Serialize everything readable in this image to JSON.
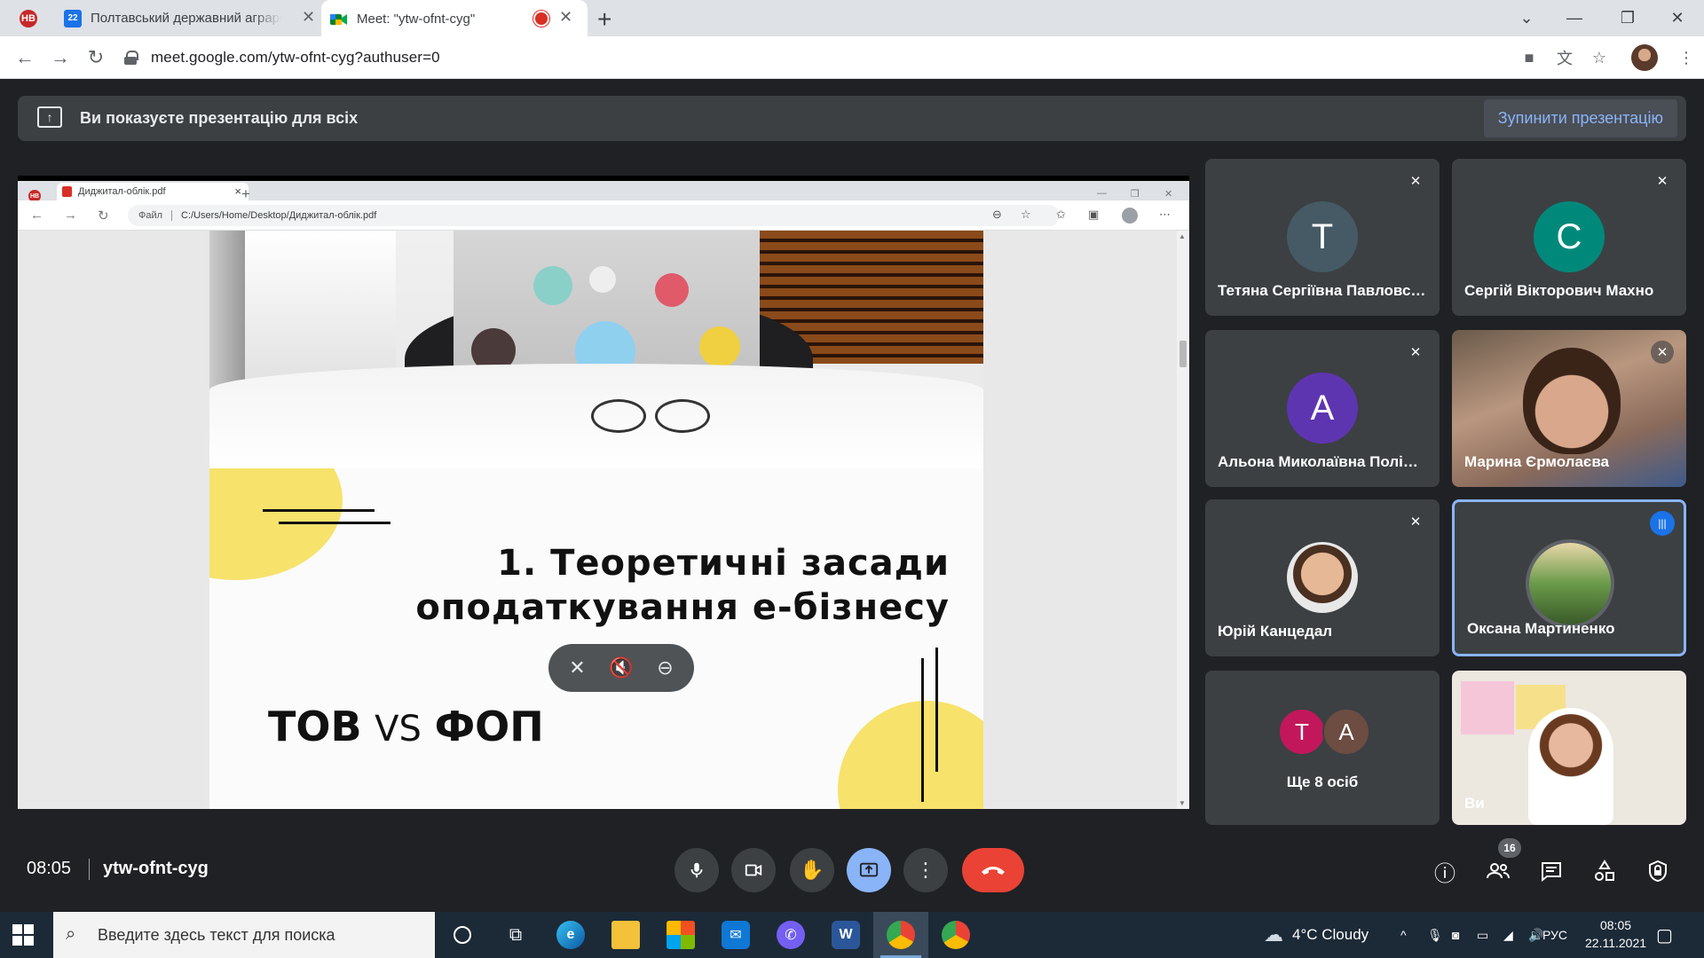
{
  "browser": {
    "tab_badge": "НВ",
    "tab1_title": "Полтавський державний аграрний",
    "tab1_favicon": "22",
    "tab2_title": "Meet: \"ytw-ofnt-cyg\"",
    "close_glyph": "✕",
    "new_tab_glyph": "+",
    "url": "meet.google.com/ytw-ofnt-cyg?authuser=0"
  },
  "banner": {
    "text": "Ви показуєте презентацію для всіх",
    "stop_label": "Зупинити презентацію"
  },
  "shared_screen": {
    "tab_title": "Диджитал-облік.pdf",
    "badge": "НВ",
    "file_label": "Файл",
    "path": "C:/Users/Home/Desktop/Диджитал-облік.pdf",
    "slide_title_line1": "1. Теоретичні засади",
    "slide_title_line2": "оподаткування е-бізнесу",
    "slide_sub_left": "ТОВ",
    "slide_sub_vs": "VS",
    "slide_sub_right": "ФОП"
  },
  "participants": [
    {
      "name": "Тетяна Сергіївна Павловська",
      "initial": "T",
      "color": "#455a64"
    },
    {
      "name": "Сергій Вікторович Махно",
      "initial": "C",
      "color": "#00897b"
    },
    {
      "name": "Альона Миколаївна Поліщук",
      "initial": "A",
      "color": "#5e35b1"
    },
    {
      "name": "Марина Єрмолаєва"
    },
    {
      "name": "Юрій Канцедал"
    },
    {
      "name": "Оксана Мартиненко"
    },
    {
      "more_label": "Ще 8 осіб",
      "initial_1": "T",
      "initial_2": "A"
    },
    {
      "name": "Ви"
    }
  ],
  "meeting": {
    "time": "08:05",
    "code": "ytw-ofnt-cyg",
    "participant_count": "16"
  },
  "taskbar": {
    "search_placeholder": "Введите здесь текст для поиска",
    "weather": "4°C  Cloudy",
    "lang": "РУС",
    "time": "08:05",
    "date": "22.11.2021"
  },
  "colors": {
    "meet_bg": "#202124",
    "accent_blue": "#8ab4f8",
    "end_call_red": "#ea4335",
    "slide_yellow": "#f7e26b"
  }
}
